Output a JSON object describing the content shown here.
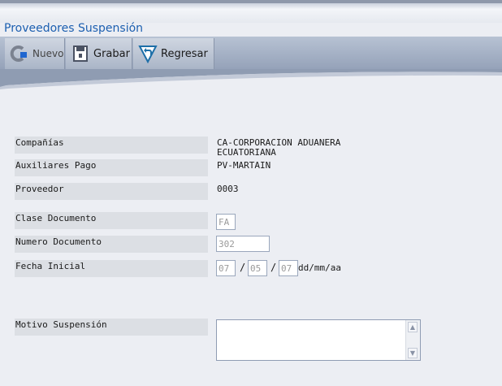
{
  "header": {
    "title": "Proveedores Suspensión"
  },
  "toolbar": {
    "nuevo_label": "Nuevo",
    "grabar_label": "Grabar",
    "regresar_label": "Regresar"
  },
  "form": {
    "companias": {
      "label": "Compañías",
      "value_line1": "CA-CORPORACION ADUANERA",
      "value_line2": "ECUATORIANA"
    },
    "auxiliares": {
      "label": "Auxiliares Pago",
      "value": "PV-MARTAIN"
    },
    "proveedor": {
      "label": "Proveedor",
      "value": "0003"
    },
    "clase_documento": {
      "label": "Clase Documento",
      "value": "FA"
    },
    "numero_documento": {
      "label": "Numero Documento",
      "value": "302"
    },
    "fecha_inicial": {
      "label": "Fecha Inicial",
      "day": "07",
      "month": "05",
      "year": "07",
      "separator": "/",
      "format": "dd/mm/aa"
    },
    "motivo": {
      "label": "Motivo Suspensión",
      "value": ""
    }
  }
}
